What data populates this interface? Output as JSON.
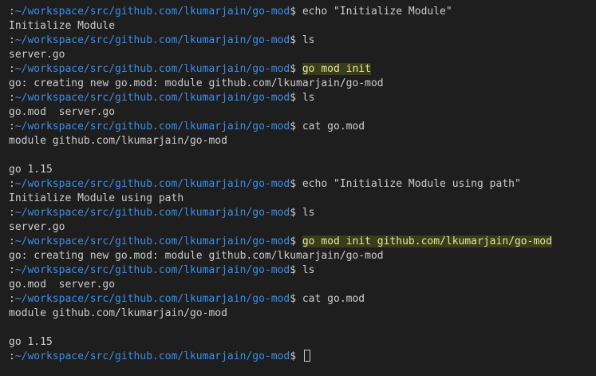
{
  "terminal": {
    "prompt_prefix": ":",
    "prompt_path": "~/workspace/src/github.com/lkumarjain/go-mod",
    "prompt_symbol": "$ ",
    "lines": [
      {
        "type": "cmd",
        "text": "echo \"Initialize Module\"",
        "highlight": false
      },
      {
        "type": "out",
        "text": "Initialize Module"
      },
      {
        "type": "cmd",
        "text": "ls",
        "highlight": false
      },
      {
        "type": "out",
        "text": "server.go"
      },
      {
        "type": "cmd",
        "text": "go mod init",
        "highlight": true
      },
      {
        "type": "out",
        "text": "go: creating new go.mod: module github.com/lkumarjain/go-mod"
      },
      {
        "type": "cmd",
        "text": "ls",
        "highlight": false
      },
      {
        "type": "out",
        "text": "go.mod  server.go"
      },
      {
        "type": "cmd",
        "text": "cat go.mod",
        "highlight": false
      },
      {
        "type": "out",
        "text": "module github.com/lkumarjain/go-mod"
      },
      {
        "type": "out",
        "text": ""
      },
      {
        "type": "out",
        "text": "go 1.15"
      },
      {
        "type": "cmd",
        "text": "echo \"Initialize Module using path\"",
        "highlight": false
      },
      {
        "type": "out",
        "text": "Initialize Module using path"
      },
      {
        "type": "cmd",
        "text": "ls",
        "highlight": false
      },
      {
        "type": "out",
        "text": "server.go"
      },
      {
        "type": "cmd",
        "text": "go mod init github.com/lkumarjain/go-mod",
        "highlight": true
      },
      {
        "type": "out",
        "text": "go: creating new go.mod: module github.com/lkumarjain/go-mod"
      },
      {
        "type": "cmd",
        "text": "ls",
        "highlight": false
      },
      {
        "type": "out",
        "text": "go.mod  server.go"
      },
      {
        "type": "cmd",
        "text": "cat go.mod",
        "highlight": false
      },
      {
        "type": "out",
        "text": "module github.com/lkumarjain/go-mod"
      },
      {
        "type": "out",
        "text": ""
      },
      {
        "type": "out",
        "text": "go 1.15"
      },
      {
        "type": "prompt",
        "text": ""
      }
    ]
  }
}
